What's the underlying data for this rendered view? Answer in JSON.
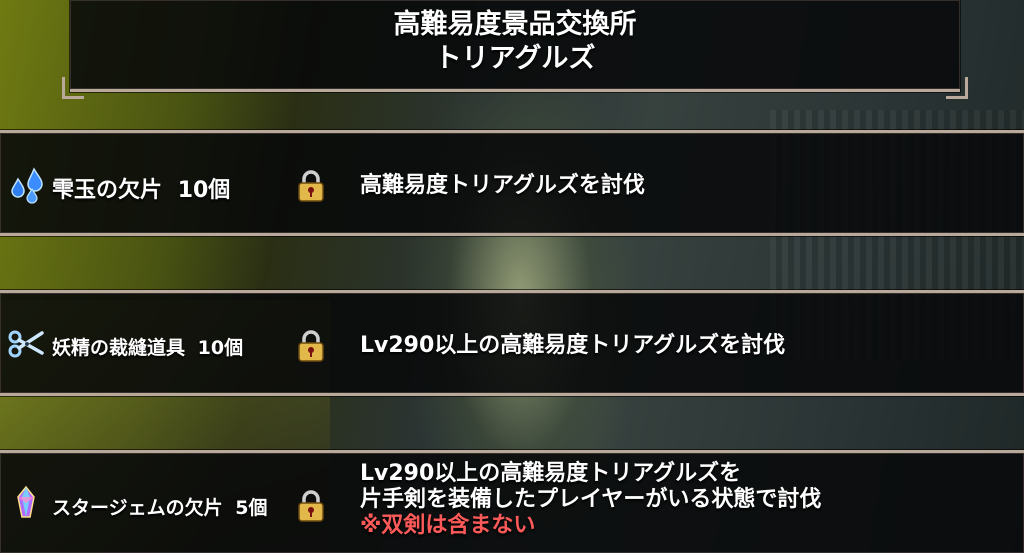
{
  "header": {
    "title_line1": "高難易度景品交換所",
    "title_line2": "トリアグルズ"
  },
  "rewards": [
    {
      "item_name": "雫玉の欠片",
      "quantity": "10個",
      "icon": "water-drops-icon",
      "locked": true,
      "condition_lines": [
        "高難易度トリアグルズを討伐"
      ]
    },
    {
      "item_name": "妖精の裁縫道具",
      "quantity": "10個",
      "icon": "scissors-icon",
      "locked": true,
      "condition_lines": [
        "Lv290以上の高難易度トリアグルズを討伐"
      ]
    },
    {
      "item_name": "スタージェムの欠片",
      "quantity": "5個",
      "icon": "star-gem-icon",
      "locked": true,
      "condition_lines": [
        "Lv290以上の高難易度トリアグルズを",
        "片手剣を装備したプレイヤーがいる状態で討伐"
      ],
      "note": "※双剣は含まない"
    }
  ],
  "colors": {
    "frame": "#b9a99a",
    "note": "#ff5a5a",
    "lock_gold": "#e2b84a"
  }
}
